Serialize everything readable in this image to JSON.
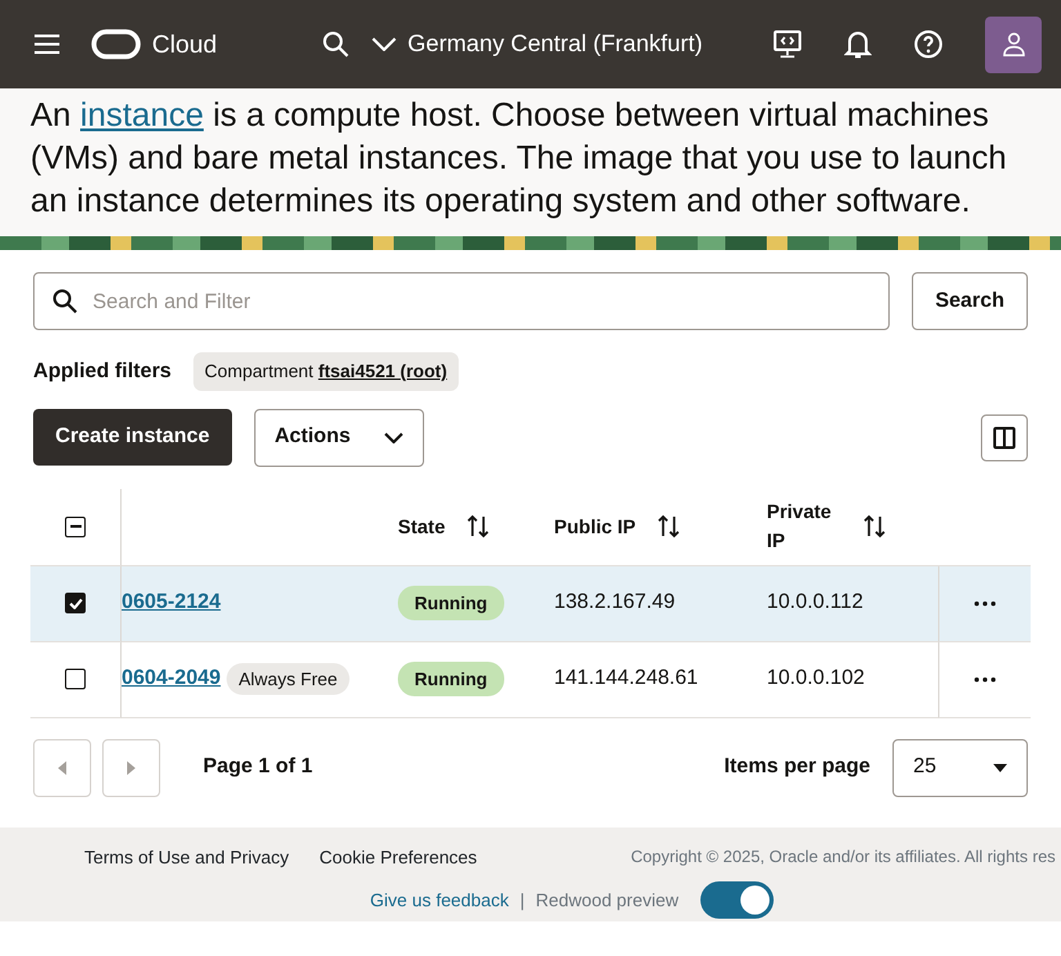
{
  "header": {
    "brand": "Cloud",
    "region": "Germany Central (Frankfurt)"
  },
  "intro": {
    "before": "An ",
    "link": "instance",
    "after": " is a compute host. Choose between virtual machines (VMs) and bare metal instances. The image that you use to launch an instance determines its operating system and other software."
  },
  "search": {
    "placeholder": "Search and Filter",
    "button": "Search"
  },
  "filters": {
    "label": "Applied filters",
    "chip_name": "Compartment",
    "chip_value": "ftsai4521 (root)"
  },
  "toolbar": {
    "create": "Create instance",
    "actions": "Actions"
  },
  "table": {
    "select_all_indeterminate": true,
    "columns": [
      "State",
      "Public IP",
      "Private IP"
    ],
    "rows": [
      {
        "selected": true,
        "name": "0605-2124",
        "tag": null,
        "state": "Running",
        "public_ip": "138.2.167.49",
        "private_ip": "10.0.0.112"
      },
      {
        "selected": false,
        "name": "0604-2049",
        "tag": "Always Free",
        "state": "Running",
        "public_ip": "141.144.248.61",
        "private_ip": "10.0.0.102"
      }
    ]
  },
  "pagination": {
    "page": "Page 1 of 1",
    "per_page_label": "Items per page",
    "per_page": "25"
  },
  "footer": {
    "links": [
      "Terms of Use and Privacy",
      "Cookie Preferences"
    ],
    "copyright": "Copyright © 2025, Oracle and/or its affiliates. All rights res",
    "feedback": "Give us feedback",
    "separator": "|",
    "preview_label": "Redwood preview",
    "preview_on": true
  }
}
